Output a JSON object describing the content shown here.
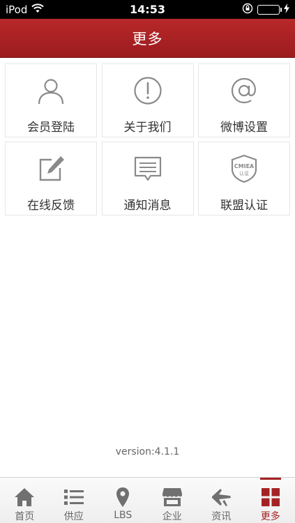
{
  "status": {
    "carrier": "iPod",
    "time": "14:53",
    "wifi_icon": "wifi-icon",
    "lock_icon": "rotation-lock-icon",
    "battery_icon": "battery-icon",
    "charging_icon": "charging-bolt-icon"
  },
  "header": {
    "title": "更多"
  },
  "tiles": [
    {
      "label": "会员登陆",
      "icon": "user-icon"
    },
    {
      "label": "关于我们",
      "icon": "info-exclamation-icon"
    },
    {
      "label": "微博设置",
      "icon": "at-sign-icon"
    },
    {
      "label": "在线反馈",
      "icon": "edit-icon"
    },
    {
      "label": "通知消息",
      "icon": "message-icon"
    },
    {
      "label": "联盟认证",
      "icon": "cmiea-badge-icon",
      "badge_text": "CMIEA",
      "badge_sub": "认证"
    }
  ],
  "footer": {
    "version": "version:4.1.1"
  },
  "tabs": [
    {
      "label": "首页",
      "icon": "home-icon",
      "active": false
    },
    {
      "label": "供应",
      "icon": "list-icon",
      "active": false
    },
    {
      "label": "LBS",
      "icon": "location-pin-icon",
      "active": false
    },
    {
      "label": "企业",
      "icon": "store-icon",
      "active": false
    },
    {
      "label": "资讯",
      "icon": "plane-icon",
      "active": false
    },
    {
      "label": "更多",
      "icon": "grid-icon",
      "active": true
    }
  ],
  "colors": {
    "accent": "#a52224",
    "icon_gray": "#8a8a8a"
  }
}
